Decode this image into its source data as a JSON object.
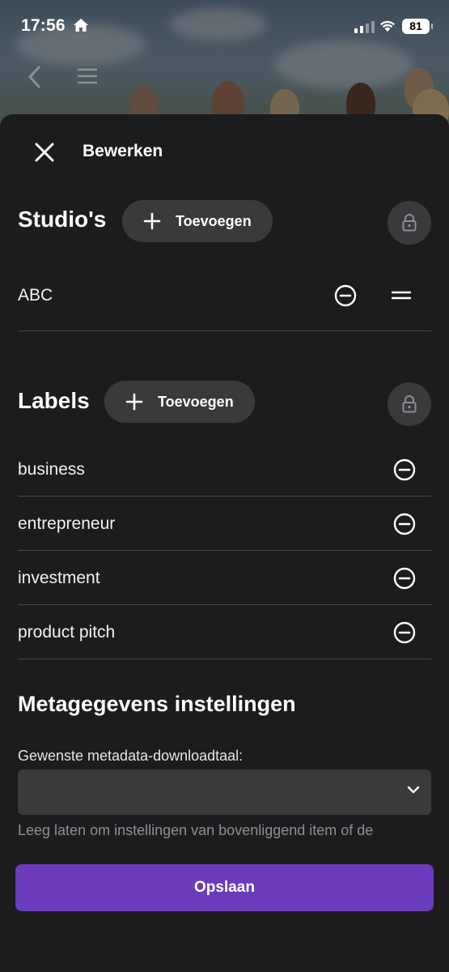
{
  "status_bar": {
    "time": "17:56",
    "battery": "81"
  },
  "header": {
    "title": "Bewerken"
  },
  "studios": {
    "title": "Studio's",
    "add_label": "Toevoegen",
    "items": [
      {
        "label": "ABC"
      }
    ]
  },
  "labels": {
    "title": "Labels",
    "add_label": "Toevoegen",
    "items": [
      {
        "label": "business"
      },
      {
        "label": "entrepreneur"
      },
      {
        "label": "investment"
      },
      {
        "label": "product pitch"
      }
    ]
  },
  "metadata": {
    "title": "Metagegevens instellingen",
    "language_label": "Gewenste metadata-downloadtaal:",
    "language_value": "",
    "hint": "Leeg laten om instellingen van bovenliggend item of de"
  },
  "save_label": "Opslaan",
  "colors": {
    "accent": "#6a3bbd",
    "background": "#1c1c1e",
    "button": "#3a3a3c"
  }
}
